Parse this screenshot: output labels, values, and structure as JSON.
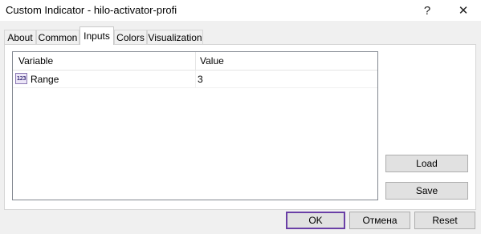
{
  "window": {
    "title": "Custom Indicator - hilo-activator-profi",
    "help_glyph": "?",
    "close_glyph": "✕"
  },
  "tabs": [
    {
      "label": "About"
    },
    {
      "label": "Common"
    },
    {
      "label": "Inputs",
      "active": true
    },
    {
      "label": "Colors"
    },
    {
      "label": "Visualization"
    }
  ],
  "inputs_table": {
    "columns": [
      "Variable",
      "Value"
    ],
    "rows": [
      {
        "type_icon": "int-type-icon",
        "type_badge": "123",
        "variable": "Range",
        "value": "3"
      }
    ]
  },
  "side_buttons": {
    "load": "Load",
    "save": "Save"
  },
  "footer_buttons": {
    "ok": "OK",
    "cancel": "Отмена",
    "reset": "Reset"
  },
  "colors": {
    "default_button_border": "#6a3fa6",
    "icon_border": "#8b78b4"
  }
}
